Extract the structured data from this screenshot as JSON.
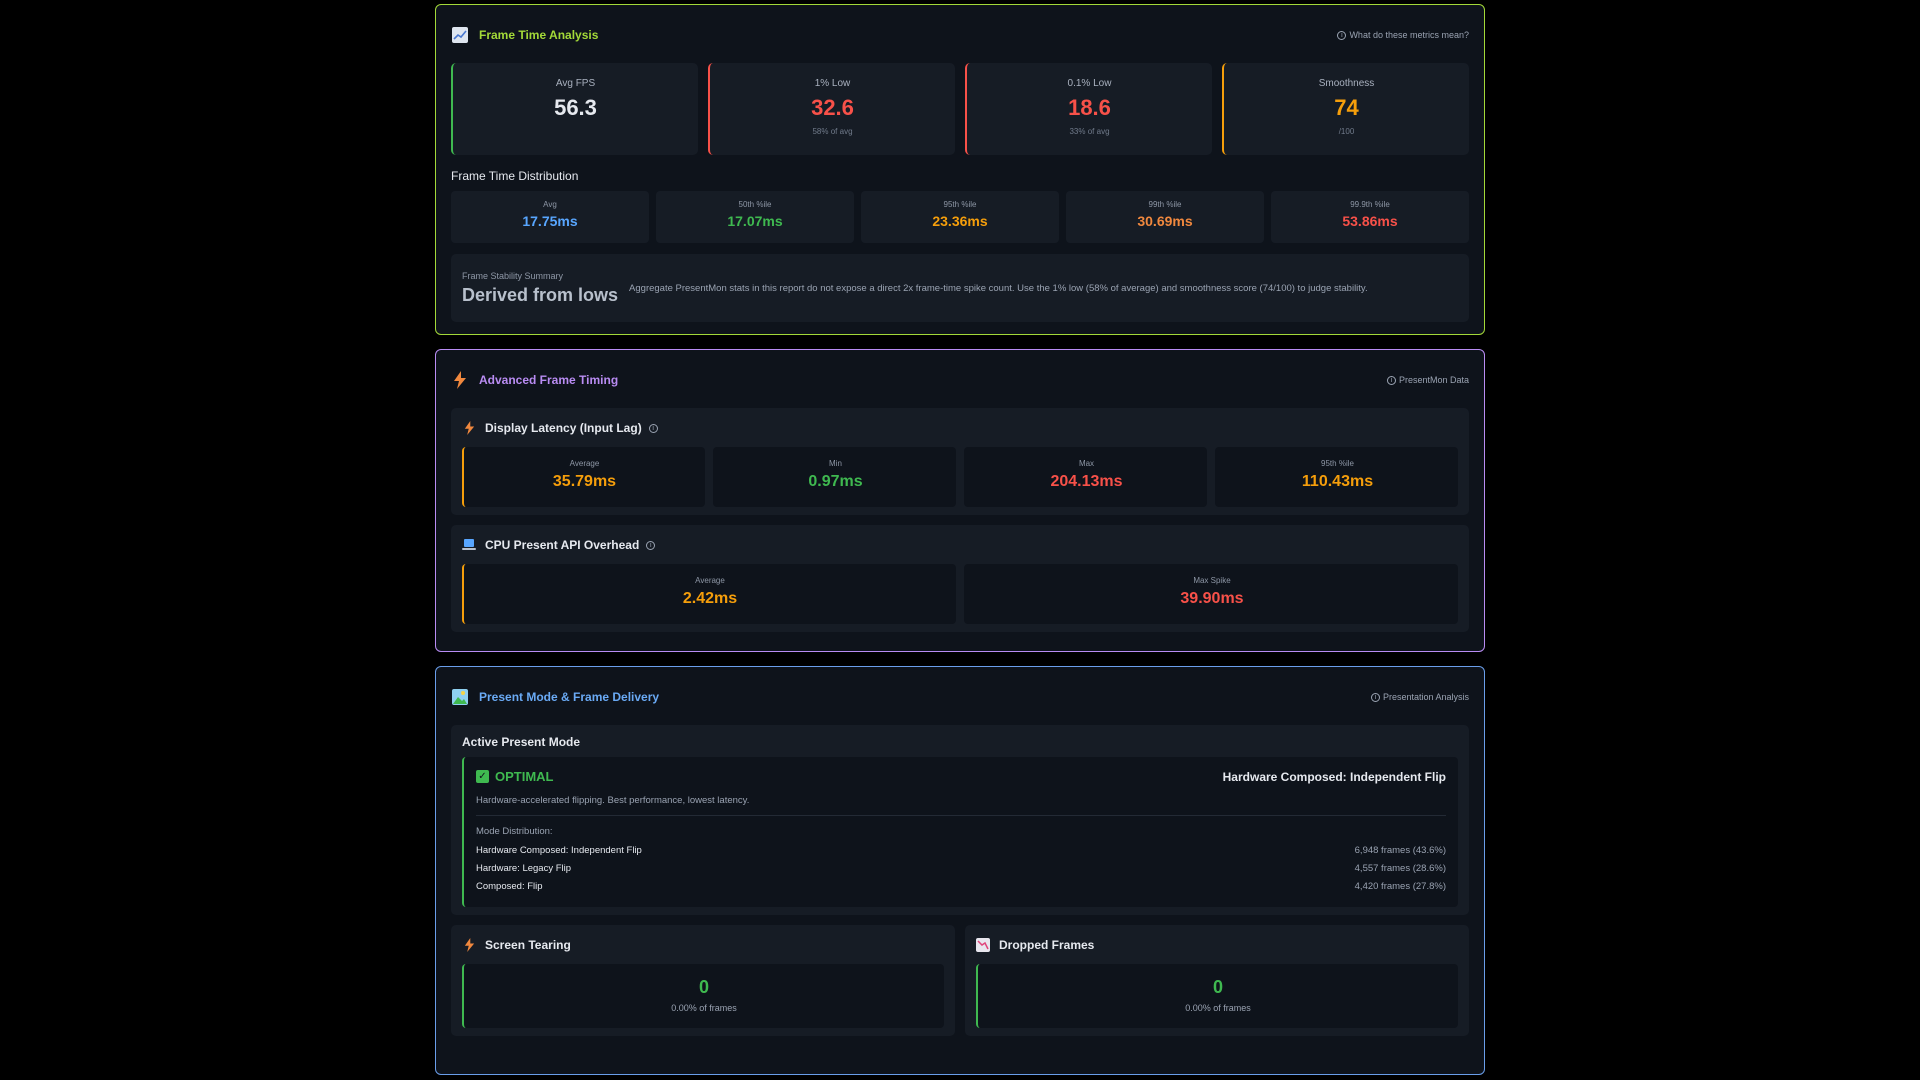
{
  "colors": {
    "green": "#3fb950",
    "red": "#f85149",
    "orange": "#f59e0b",
    "blue": "#58a6ff",
    "lime_border": "#a3d938",
    "purple_border": "#b98cf3",
    "blue_border": "#6a9eea"
  },
  "frame_time": {
    "icon": "chart-icon",
    "title": "Frame Time Analysis",
    "info": "What do these metrics mean?",
    "metrics": [
      {
        "label": "Avg FPS",
        "value": "56.3",
        "sub": ""
      },
      {
        "label": "1% Low",
        "value": "32.6",
        "sub": "58% of avg"
      },
      {
        "label": "0.1% Low",
        "value": "18.6",
        "sub": "33% of avg"
      },
      {
        "label": "Smoothness",
        "value": "74",
        "sub": "/100"
      }
    ],
    "dist_title": "Frame Time Distribution",
    "distribution": [
      {
        "label": "Avg",
        "value": "17.75ms"
      },
      {
        "label": "50th %ile",
        "value": "17.07ms"
      },
      {
        "label": "95th %ile",
        "value": "23.36ms"
      },
      {
        "label": "99th %ile",
        "value": "30.69ms"
      },
      {
        "label": "99.9th %ile",
        "value": "53.86ms"
      }
    ],
    "stability": {
      "label": "Frame Stability Summary",
      "value": "Derived from lows",
      "desc": "Aggregate PresentMon stats in this report do not expose a direct 2x frame-time spike count. Use the 1% low (58% of average) and smoothness score (74/100) to judge stability."
    }
  },
  "advanced": {
    "icon": "lightning-icon",
    "title": "Advanced Frame Timing",
    "info": "PresentMon Data",
    "latency": {
      "title": "Display Latency (Input Lag)",
      "cards": [
        {
          "label": "Average",
          "value": "35.79ms"
        },
        {
          "label": "Min",
          "value": "0.97ms"
        },
        {
          "label": "Max",
          "value": "204.13ms"
        },
        {
          "label": "95th %ile",
          "value": "110.43ms"
        }
      ]
    },
    "cpu": {
      "title": "CPU Present API Overhead",
      "cards": [
        {
          "label": "Average",
          "value": "2.42ms"
        },
        {
          "label": "Max Spike",
          "value": "39.90ms"
        }
      ]
    }
  },
  "present": {
    "icon": "image-icon",
    "title": "Present Mode & Frame Delivery",
    "info": "Presentation Analysis",
    "active_title": "Active Present Mode",
    "status": "OPTIMAL",
    "mode": "Hardware Composed: Independent Flip",
    "desc": "Hardware-accelerated flipping. Best performance, lowest latency.",
    "dist_label": "Mode Distribution:",
    "modes": [
      {
        "name": "Hardware Composed: Independent Flip",
        "frames": "6,948 frames (43.6%)"
      },
      {
        "name": "Hardware: Legacy Flip",
        "frames": "4,557 frames (28.6%)"
      },
      {
        "name": "Composed: Flip",
        "frames": "4,420 frames (27.8%)"
      }
    ],
    "tearing": {
      "title": "Screen Tearing",
      "value": "0",
      "sub": "0.00% of frames"
    },
    "dropped": {
      "title": "Dropped Frames",
      "value": "0",
      "sub": "0.00% of frames"
    }
  }
}
